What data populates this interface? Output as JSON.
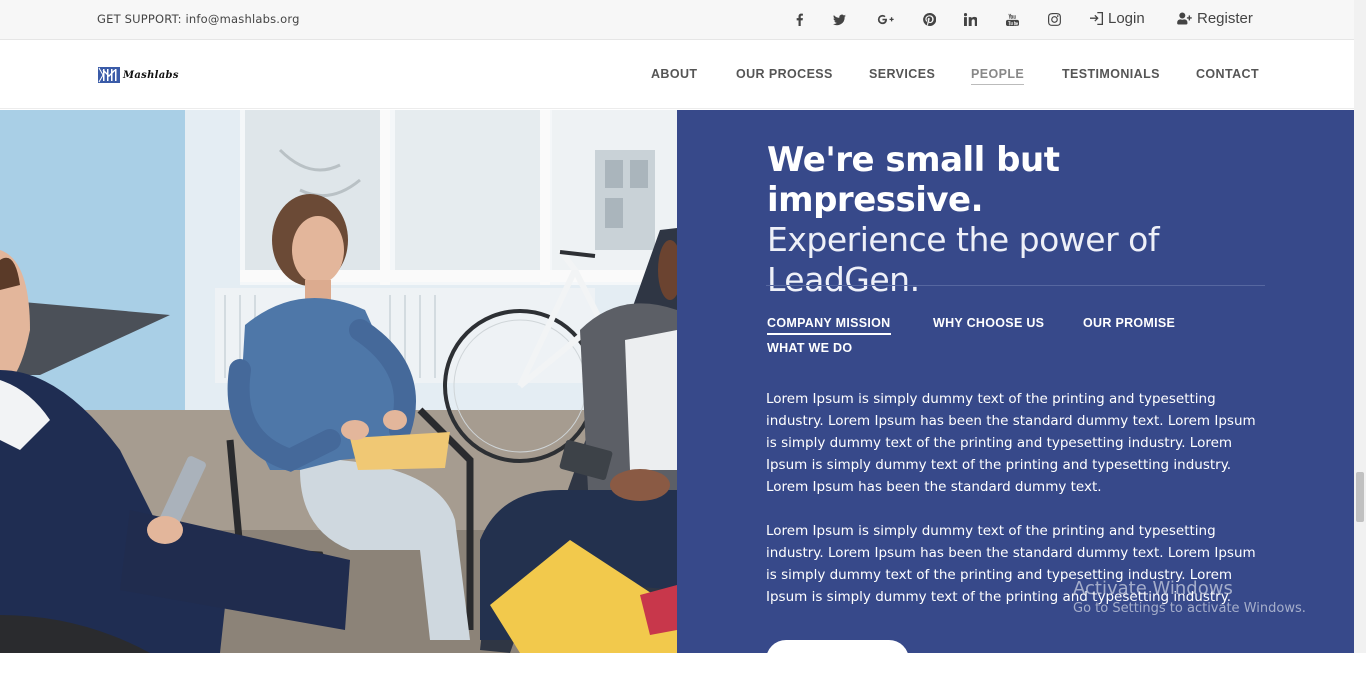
{
  "topbar": {
    "support_text": "GET SUPPORT: info@mashlabs.org",
    "socials": [
      "facebook-icon",
      "twitter-icon",
      "google-plus-icon",
      "pinterest-icon",
      "linkedin-icon",
      "youtube-icon",
      "instagram-icon"
    ],
    "login_label": "Login",
    "register_label": "Register"
  },
  "nav": {
    "logo_text": "Mashlabs",
    "items": [
      "ABOUT",
      "OUR PROCESS",
      "SERVICES",
      "PEOPLE",
      "TESTIMONIALS",
      "CONTACT"
    ],
    "active": "PEOPLE"
  },
  "hero": {
    "headline_strong": "We're small but impressive.",
    "headline_light_1": "Experience the power of",
    "headline_light_2": "LeadGen.",
    "tabs": [
      "COMPANY MISSION",
      "WHY CHOOSE US",
      "OUR PROMISE",
      "WHAT WE DO"
    ],
    "active_tab": "COMPANY MISSION",
    "paragraph_1": "Lorem Ipsum is simply dummy text of the printing and typesetting industry. Lorem Ipsum has been the standard dummy text. Lorem Ipsum is simply dummy text of the printing and typesetting industry. Lorem Ipsum is simply dummy text of the printing and typesetting industry. Lorem Ipsum has been the standard dummy text.",
    "paragraph_2": "Lorem Ipsum is simply dummy text of the printing and typesetting industry. Lorem Ipsum has been the standard dummy text. Lorem Ipsum is simply dummy text of the printing and typesetting industry. Lorem Ipsum is simply dummy text of the printing and typesetting industry."
  },
  "colors": {
    "panel_bg": "#37498a",
    "topbar_bg": "#f7f7f7"
  },
  "watermark": {
    "line1": "Activate Windows",
    "line2": "Go to Settings to activate Windows."
  }
}
